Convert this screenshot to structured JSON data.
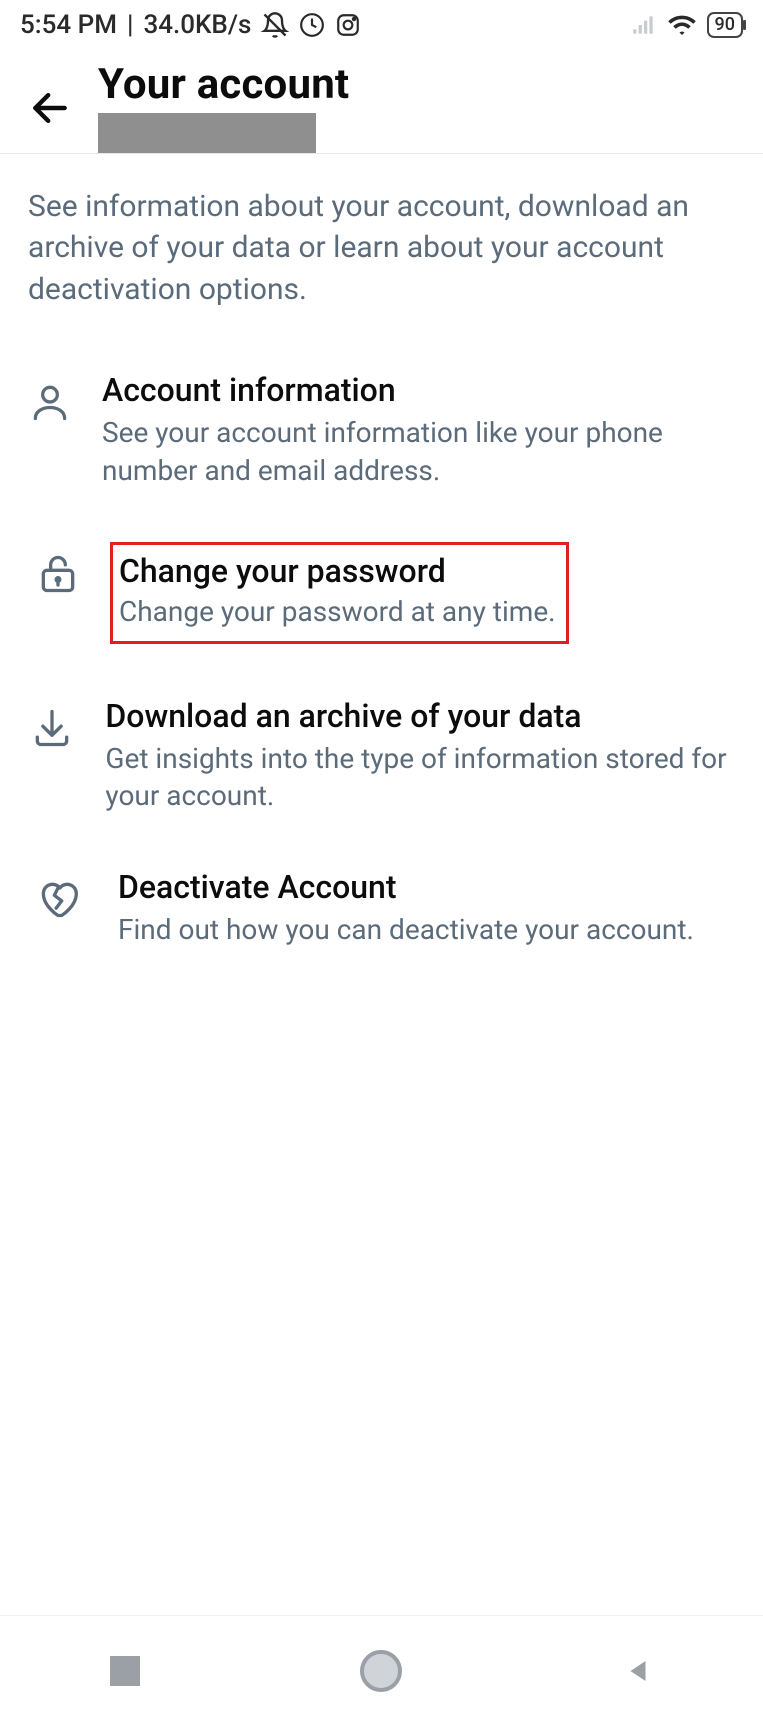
{
  "status_bar": {
    "time": "5:54 PM",
    "net_speed": "34.0KB/s",
    "battery": "90"
  },
  "header": {
    "title": "Your account"
  },
  "description": "See information about your account, download an archive of your data or learn about your account deactivation options.",
  "menu": {
    "account_info": {
      "title": "Account information",
      "subtitle": "See your account information like your phone number and email address."
    },
    "change_password": {
      "title": "Change your password",
      "subtitle": "Change your password at any time."
    },
    "download_archive": {
      "title": "Download an archive of your data",
      "subtitle": "Get insights into the type of information stored for your account."
    },
    "deactivate": {
      "title": "Deactivate Account",
      "subtitle": "Find out how you can deactivate your account."
    }
  }
}
